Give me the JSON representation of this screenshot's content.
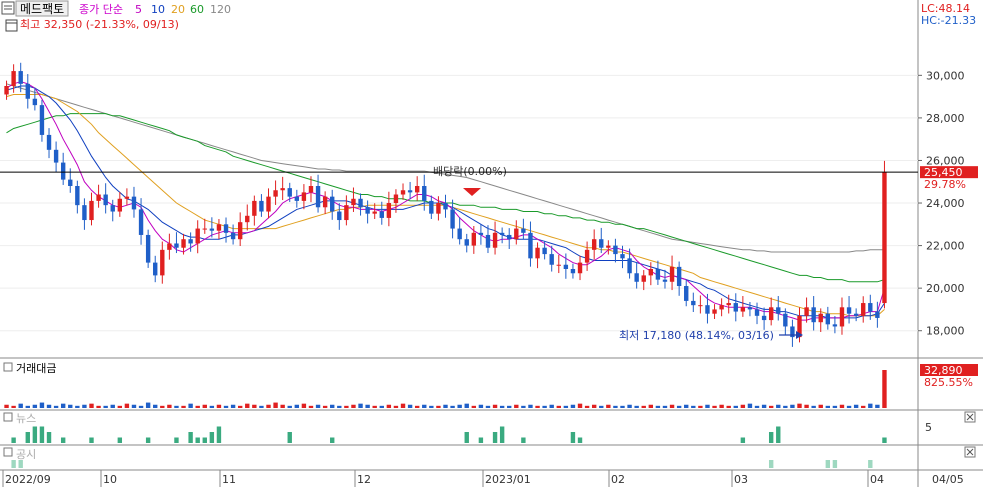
{
  "header": {
    "symbol": "메드팩토",
    "ma_label": "종가 단순",
    "ma_periods": [
      {
        "label": "5",
        "color": "#c0c"
      },
      {
        "label": "10",
        "color": "#1040c0"
      },
      {
        "label": "20",
        "color": "#e0a020"
      },
      {
        "label": "60",
        "color": "#1a9a2a"
      },
      {
        "label": "120",
        "color": "#888888"
      }
    ],
    "lc": "LC:48.14",
    "hc": "HC:-21.33"
  },
  "annotations": {
    "high": "최고 32,350 (-21.33%, 09/13)",
    "low": "최저 17,180 (48.14%, 03/16)",
    "dividend": "배당락(0.00%)",
    "price_tag": "25,450",
    "price_pct": "29.78%"
  },
  "panels": {
    "volume_title": "거래대금",
    "volume_tag": "32,890",
    "volume_pct": "825.55%",
    "news_title": "뉴스",
    "news_tick": "5",
    "disclosure_title": "공시"
  },
  "colors": {
    "up": "#e02020",
    "down": "#1f5fc8",
    "ma5": "#c000c0",
    "ma10": "#1040c0",
    "ma20": "#e0a020",
    "ma60": "#1a9a2a",
    "ma120": "#888888",
    "news": "#3aaa80",
    "disclosure": "#9ed8c0"
  },
  "chart_data": {
    "type": "candlestick",
    "y_ticks": [
      "30,000",
      "28,000",
      "26,000",
      "24,000",
      "22,000",
      "20,000",
      "18,000"
    ],
    "y_tick_values": [
      30000,
      28000,
      26000,
      24000,
      22000,
      20000,
      18000
    ],
    "ylim": [
      17000,
      32600
    ],
    "x_labels": [
      "2022/09",
      "10",
      "11",
      "12",
      "2023/01",
      "02",
      "03",
      "04",
      "04/05"
    ],
    "current_price": 25450,
    "close": [
      29500,
      30200,
      29600,
      28900,
      28600,
      27200,
      26500,
      25900,
      25100,
      24800,
      23900,
      23200,
      24100,
      24400,
      23900,
      23600,
      24200,
      24300,
      23700,
      22500,
      21200,
      20600,
      21800,
      22100,
      21900,
      22300,
      22100,
      22800,
      22800,
      22700,
      23000,
      22600,
      22300,
      23100,
      23400,
      24100,
      23600,
      24300,
      24600,
      24700,
      24300,
      24100,
      24500,
      24800,
      23800,
      24300,
      23600,
      23200,
      23900,
      24200,
      23800,
      23500,
      23600,
      23300,
      24000,
      24400,
      24600,
      24500,
      24800,
      24100,
      23500,
      24000,
      23700,
      22800,
      22300,
      22000,
      22600,
      22500,
      21900,
      22600,
      22500,
      22300,
      22800,
      22600,
      21400,
      21900,
      21600,
      21100,
      21100,
      20900,
      20700,
      21200,
      21800,
      22300,
      21900,
      22000,
      21600,
      21400,
      20700,
      20300,
      20600,
      20900,
      20400,
      20300,
      21000,
      20100,
      19400,
      19200,
      19200,
      18800,
      19000,
      19200,
      19300,
      18900,
      19100,
      19000,
      18700,
      18500,
      19100,
      18800,
      18200,
      17700,
      18700,
      19100,
      18400,
      18800,
      18300,
      18200,
      19100,
      18800,
      18700,
      19300,
      18900,
      18600,
      25450
    ],
    "open": [
      29100,
      29500,
      30200,
      29600,
      28900,
      28600,
      27200,
      26500,
      25900,
      25100,
      24800,
      23900,
      23200,
      24100,
      24400,
      23900,
      23600,
      24200,
      24300,
      23700,
      22500,
      21200,
      20600,
      21800,
      22100,
      21900,
      22300,
      22100,
      22800,
      22800,
      22700,
      23000,
      22600,
      22300,
      23100,
      23400,
      24100,
      23600,
      24300,
      24600,
      24700,
      24300,
      24100,
      24500,
      24800,
      23800,
      24300,
      23600,
      23200,
      23900,
      24200,
      23800,
      23500,
      23600,
      23300,
      24000,
      24400,
      24600,
      24500,
      24800,
      24100,
      23500,
      24000,
      23700,
      22800,
      22300,
      22000,
      22600,
      22500,
      21900,
      22600,
      22500,
      22300,
      22800,
      22600,
      21400,
      21900,
      21600,
      21100,
      21100,
      20900,
      20700,
      21200,
      21800,
      22300,
      21900,
      22000,
      21600,
      21400,
      20700,
      20300,
      20600,
      20900,
      20400,
      20300,
      21000,
      20100,
      19400,
      19200,
      19200,
      18800,
      19000,
      19200,
      19300,
      18900,
      19100,
      19000,
      18700,
      18500,
      19100,
      18800,
      18200,
      17700,
      18700,
      19100,
      18400,
      18800,
      18300,
      18200,
      19100,
      18800,
      18700,
      19300,
      18900,
      19300
    ],
    "ma5": [
      29400,
      29600,
      29700,
      29600,
      29400,
      28900,
      28300,
      27700,
      27000,
      26400,
      25800,
      25000,
      24600,
      24300,
      24100,
      23900,
      23800,
      23900,
      24000,
      23800,
      23200,
      22700,
      22300,
      22100,
      21800,
      21700,
      21900,
      22100,
      22300,
      22500,
      22600,
      22700,
      22600,
      22600,
      22600,
      22700,
      23000,
      23300,
      23600,
      24000,
      24200,
      24300,
      24400,
      24500,
      24400,
      24300,
      24100,
      23900,
      23800,
      23800,
      23700,
      23700,
      23700,
      23600,
      23700,
      23800,
      24000,
      24200,
      24400,
      24400,
      24300,
      24100,
      24000,
      23700,
      23300,
      23000,
      22700,
      22500,
      22300,
      22200,
      22300,
      22300,
      22400,
      22500,
      22500,
      22300,
      22100,
      21900,
      21600,
      21400,
      21200,
      21100,
      21100,
      21300,
      21500,
      21800,
      21900,
      21800,
      21700,
      21300,
      21000,
      20800,
      20600,
      20500,
      20600,
      20500,
      20400,
      20100,
      19800,
      19500,
      19300,
      19200,
      19100,
      19100,
      19100,
      19100,
      19000,
      18900,
      18900,
      18800,
      18700,
      18600,
      18500,
      18500,
      18600,
      18600,
      18600,
      18600,
      18600,
      18700,
      18700,
      18800,
      18900,
      18900,
      20000
    ],
    "ma10": [
      29300,
      29400,
      29500,
      29500,
      29400,
      29200,
      29000,
      28700,
      28300,
      27900,
      27400,
      26800,
      26200,
      25700,
      25200,
      24800,
      24500,
      24200,
      24100,
      23900,
      23700,
      23400,
      23100,
      22900,
      22700,
      22500,
      22400,
      22400,
      22300,
      22300,
      22300,
      22400,
      22500,
      22500,
      22600,
      22700,
      22800,
      22900,
      23100,
      23300,
      23500,
      23700,
      23800,
      23900,
      24000,
      24100,
      24100,
      24100,
      24100,
      24000,
      23900,
      23800,
      23700,
      23700,
      23700,
      23700,
      23700,
      23800,
      23900,
      24000,
      24000,
      24000,
      23900,
      23800,
      23600,
      23400,
      23200,
      23000,
      22800,
      22700,
      22500,
      22400,
      22300,
      22300,
      22300,
      22300,
      22200,
      22100,
      22000,
      21900,
      21700,
      21500,
      21400,
      21300,
      21300,
      21300,
      21300,
      21300,
      21300,
      21200,
      21100,
      21000,
      20900,
      20800,
      20600,
      20500,
      20400,
      20300,
      20200,
      20000,
      19900,
      19700,
      19500,
      19400,
      19300,
      19200,
      19100,
      19000,
      19000,
      18900,
      18900,
      18800,
      18700,
      18700,
      18700,
      18700,
      18600,
      18600,
      18600,
      18600,
      18600,
      18700,
      18700,
      18800,
      19300
    ],
    "ma20": [
      29000,
      29100,
      29100,
      29100,
      29100,
      29100,
      29000,
      28900,
      28700,
      28500,
      28300,
      28000,
      27700,
      27300,
      27000,
      26700,
      26400,
      26100,
      25800,
      25500,
      25200,
      24900,
      24600,
      24300,
      24000,
      23800,
      23600,
      23400,
      23200,
      23100,
      23000,
      22900,
      22800,
      22800,
      22800,
      22800,
      22800,
      22800,
      22800,
      22900,
      23000,
      23100,
      23200,
      23300,
      23400,
      23500,
      23600,
      23700,
      23700,
      23800,
      23800,
      23900,
      23900,
      23900,
      23900,
      23900,
      23900,
      23900,
      23900,
      23900,
      23900,
      23900,
      23900,
      23800,
      23700,
      23600,
      23500,
      23400,
      23300,
      23200,
      23100,
      23000,
      22900,
      22800,
      22700,
      22600,
      22500,
      22400,
      22300,
      22200,
      22100,
      22000,
      21900,
      21900,
      21800,
      21800,
      21700,
      21700,
      21600,
      21500,
      21400,
      21300,
      21200,
      21100,
      21000,
      20900,
      20800,
      20700,
      20500,
      20400,
      20300,
      20200,
      20100,
      20000,
      19900,
      19800,
      19700,
      19600,
      19500,
      19400,
      19300,
      19200,
      19100,
      19000,
      18900,
      18900,
      18800,
      18800,
      18800,
      18700,
      18700,
      18700,
      18700,
      18700,
      19000
    ],
    "ma60": [
      27300,
      27500,
      27600,
      27700,
      27800,
      27900,
      28000,
      28100,
      28100,
      28200,
      28200,
      28200,
      28200,
      28200,
      28200,
      28100,
      28100,
      28000,
      27900,
      27800,
      27700,
      27600,
      27500,
      27400,
      27200,
      27100,
      27000,
      26900,
      26700,
      26600,
      26500,
      26400,
      26200,
      26100,
      26000,
      25900,
      25800,
      25700,
      25600,
      25500,
      25400,
      25300,
      25200,
      25100,
      25000,
      24900,
      24800,
      24700,
      24600,
      24500,
      24400,
      24400,
      24300,
      24300,
      24200,
      24200,
      24200,
      24100,
      24100,
      24100,
      24000,
      24000,
      24000,
      24000,
      23900,
      23900,
      23900,
      23800,
      23800,
      23800,
      23700,
      23700,
      23700,
      23600,
      23600,
      23600,
      23500,
      23500,
      23400,
      23400,
      23300,
      23300,
      23200,
      23200,
      23100,
      23100,
      23000,
      23000,
      22900,
      22800,
      22800,
      22700,
      22600,
      22500,
      22400,
      22300,
      22200,
      22100,
      22000,
      21900,
      21800,
      21700,
      21600,
      21500,
      21400,
      21300,
      21200,
      21100,
      21000,
      20900,
      20800,
      20700,
      20600,
      20600,
      20500,
      20500,
      20400,
      20400,
      20400,
      20300,
      20300,
      20300,
      20300,
      20300,
      20400
    ],
    "ma120": [
      29600,
      29500,
      29400,
      29300,
      29200,
      29100,
      29000,
      28900,
      28800,
      28700,
      28600,
      28500,
      28400,
      28300,
      28200,
      28100,
      28000,
      27900,
      27800,
      27700,
      27600,
      27500,
      27400,
      27300,
      27200,
      27100,
      27000,
      26900,
      26800,
      26700,
      26600,
      26500,
      26400,
      26300,
      26200,
      26100,
      26000,
      25950,
      25900,
      25850,
      25800,
      25750,
      25700,
      25650,
      25600,
      25600,
      25550,
      25550,
      25500,
      25500,
      25500,
      25500,
      25500,
      25500,
      25500,
      25500,
      25500,
      25500,
      25500,
      25500,
      25450,
      25400,
      25350,
      25300,
      25250,
      25200,
      25100,
      25000,
      24900,
      24800,
      24700,
      24600,
      24500,
      24400,
      24300,
      24200,
      24100,
      24000,
      23900,
      23800,
      23700,
      23600,
      23500,
      23400,
      23300,
      23200,
      23100,
      23000,
      22900,
      22800,
      22700,
      22600,
      22500,
      22400,
      22300,
      22250,
      22200,
      22150,
      22100,
      22050,
      22000,
      21950,
      21900,
      21850,
      21800,
      21800,
      21750,
      21750,
      21700,
      21700,
      21700,
      21700,
      21700,
      21700,
      21700,
      21700,
      21700,
      21700,
      21700,
      21700,
      21750,
      21750,
      21800,
      21800,
      21800
    ],
    "volume": [
      3,
      2,
      4,
      2,
      3,
      5,
      3,
      2,
      4,
      3,
      2,
      3,
      4,
      2,
      2,
      3,
      2,
      4,
      3,
      2,
      5,
      3,
      2,
      3,
      2,
      2,
      4,
      2,
      3,
      2,
      3,
      2,
      3,
      2,
      4,
      3,
      2,
      3,
      5,
      3,
      2,
      3,
      4,
      2,
      3,
      2,
      3,
      2,
      2,
      3,
      4,
      3,
      2,
      2,
      3,
      2,
      4,
      3,
      2,
      3,
      2,
      2,
      3,
      2,
      3,
      4,
      2,
      3,
      2,
      3,
      2,
      2,
      3,
      2,
      3,
      2,
      2,
      3,
      2,
      2,
      3,
      4,
      2,
      3,
      2,
      3,
      2,
      2,
      3,
      2,
      2,
      3,
      2,
      2,
      3,
      2,
      3,
      2,
      2,
      3,
      2,
      3,
      2,
      2,
      3,
      4,
      2,
      3,
      2,
      3,
      2,
      3,
      4,
      3,
      2,
      3,
      2,
      2,
      3,
      2,
      3,
      2,
      4,
      3,
      35
    ],
    "news": [
      0,
      1,
      0,
      2,
      3,
      3,
      2,
      0,
      1,
      0,
      0,
      0,
      1,
      0,
      0,
      0,
      1,
      0,
      0,
      0,
      1,
      0,
      0,
      0,
      1,
      0,
      2,
      1,
      1,
      2,
      3,
      0,
      0,
      0,
      0,
      0,
      0,
      0,
      0,
      0,
      2,
      0,
      0,
      0,
      0,
      0,
      1,
      0,
      0,
      0,
      0,
      0,
      0,
      0,
      0,
      0,
      0,
      0,
      0,
      0,
      0,
      0,
      0,
      0,
      0,
      2,
      0,
      1,
      0,
      2,
      3,
      0,
      0,
      1,
      0,
      0,
      0,
      0,
      0,
      0,
      2,
      1,
      0,
      0,
      0,
      0,
      0,
      0,
      0,
      0,
      0,
      0,
      0,
      0,
      0,
      0,
      0,
      0,
      0,
      0,
      0,
      0,
      0,
      0,
      1,
      0,
      0,
      0,
      2,
      3,
      0,
      0,
      0,
      0,
      0,
      0,
      0,
      0,
      0,
      0,
      0,
      0,
      0,
      0,
      1
    ],
    "disclosure": [
      0,
      1,
      1,
      0,
      0,
      0,
      0,
      0,
      0,
      0,
      0,
      0,
      0,
      0,
      0,
      0,
      0,
      0,
      0,
      0,
      0,
      0,
      0,
      0,
      0,
      0,
      0,
      0,
      0,
      0,
      0,
      0,
      0,
      0,
      0,
      0,
      0,
      0,
      0,
      0,
      0,
      0,
      0,
      0,
      0,
      0,
      0,
      0,
      0,
      0,
      0,
      0,
      0,
      0,
      0,
      0,
      0,
      0,
      0,
      0,
      0,
      0,
      0,
      0,
      0,
      0,
      0,
      0,
      0,
      0,
      0,
      0,
      0,
      0,
      0,
      0,
      0,
      0,
      0,
      0,
      0,
      0,
      0,
      0,
      0,
      0,
      0,
      0,
      0,
      0,
      0,
      0,
      0,
      0,
      0,
      0,
      0,
      0,
      0,
      0,
      0,
      0,
      0,
      0,
      0,
      0,
      0,
      0,
      1,
      0,
      0,
      0,
      0,
      0,
      0,
      0,
      1,
      1,
      0,
      0,
      0,
      0,
      1,
      0,
      0
    ]
  }
}
